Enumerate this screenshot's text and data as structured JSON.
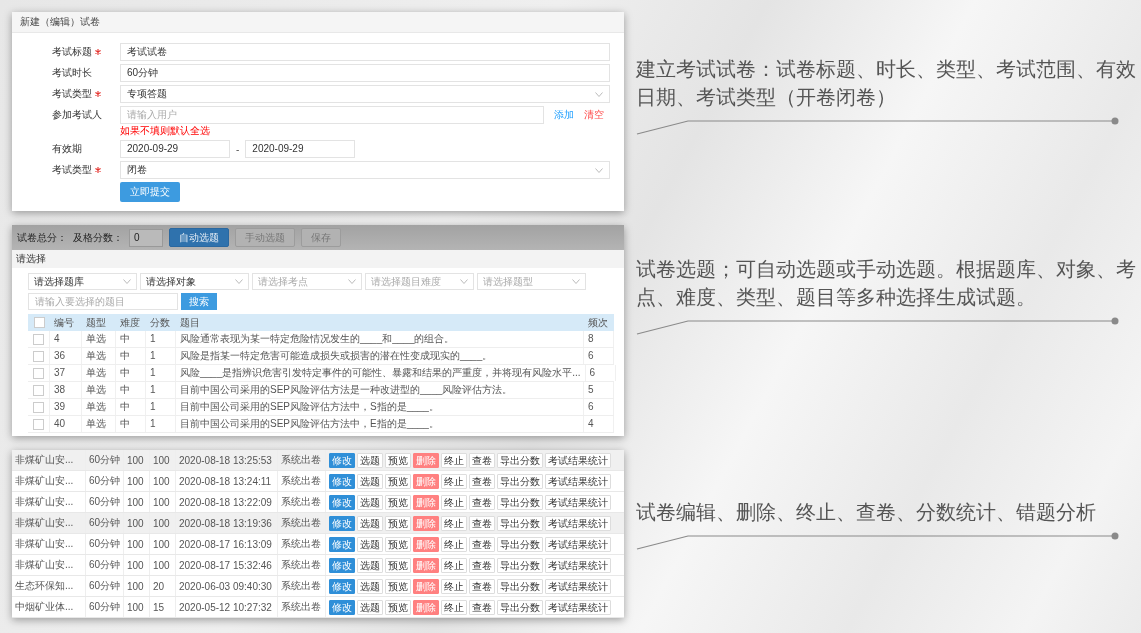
{
  "exam_form": {
    "title": "新建（编辑）试卷",
    "fields": [
      {
        "kind": "text",
        "label": "考试标题",
        "required": true,
        "value": "考试试卷"
      },
      {
        "kind": "text",
        "label": "考试时长",
        "required": false,
        "value": "60分钟"
      },
      {
        "kind": "select",
        "label": "考试类型",
        "required": true,
        "value": "专项答题"
      },
      {
        "kind": "users",
        "label": "参加考试人",
        "required": false,
        "placeholder": "请输入用户",
        "links": [
          {
            "label": "添加",
            "kind": "add"
          },
          {
            "label": "清空",
            "kind": "clear"
          }
        ],
        "hint": "如果不填则默认全选"
      },
      {
        "kind": "daterange",
        "label": "有效期",
        "required": false,
        "start": "2020-09-29",
        "separator": "-",
        "end": "2020-09-29"
      },
      {
        "kind": "select",
        "label": "考试类型",
        "required": true,
        "value": "闭卷"
      }
    ],
    "submit": "立即提交"
  },
  "question_picker": {
    "toolbar": {
      "total_label": "试卷总分：",
      "pass_label": "及格分数：",
      "pass_value": "0",
      "buttons": [
        {
          "label": "自动选题",
          "kind": "primary"
        },
        {
          "label": "手动选题",
          "kind": "plain"
        },
        {
          "label": "保存",
          "kind": "plain"
        }
      ]
    },
    "section_title": "请选择",
    "filters": [
      {
        "value": "请选择题库"
      },
      {
        "value": "请选择对象"
      },
      {
        "placeholder": "请选择考点"
      },
      {
        "placeholder": "请选择题目难度"
      },
      {
        "placeholder": "请选择题型"
      }
    ],
    "search": {
      "placeholder": "请输入要选择的题目",
      "button": "搜索"
    },
    "table": {
      "all_checked": false,
      "columns": [
        "编号",
        "题型",
        "难度",
        "分数",
        "题目",
        "频次"
      ],
      "rows": [
        {
          "checked": false,
          "cells": [
            "4",
            "单选",
            "中",
            "1",
            "风险通常表现为某一特定危险情况发生的____和____的组合。",
            "8"
          ]
        },
        {
          "checked": false,
          "cells": [
            "36",
            "单选",
            "中",
            "1",
            "风险是指某一特定危害可能造成损失或损害的潜在性变成现实的____。",
            "6"
          ]
        },
        {
          "checked": false,
          "cells": [
            "37",
            "单选",
            "中",
            "1",
            "风险____是指辨识危害引发特定事件的可能性、暴露和结果的严重度，并将现有风险水平...",
            "6"
          ]
        },
        {
          "checked": false,
          "cells": [
            "38",
            "单选",
            "中",
            "1",
            "目前中国公司采用的SEP风险评估方法是一种改进型的____风险评估方法。",
            "5"
          ]
        },
        {
          "checked": false,
          "cells": [
            "39",
            "单选",
            "中",
            "1",
            "目前中国公司采用的SEP风险评估方法中，S指的是____。",
            "6"
          ]
        },
        {
          "checked": false,
          "cells": [
            "40",
            "单选",
            "中",
            "1",
            "目前中国公司采用的SEP风险评估方法中，E指的是____。",
            "4"
          ]
        }
      ]
    }
  },
  "exam_list": {
    "rows": [
      {
        "highlighted": true,
        "cells": [
          "非煤矿山安...",
          "60分钟",
          "100",
          "100",
          "2020-08-18 13:25:53",
          "系统出卷"
        ],
        "actions": [
          {
            "label": "修改",
            "kind": "primary"
          },
          {
            "label": "选题",
            "kind": "plain"
          },
          {
            "label": "预览",
            "kind": "plain"
          },
          {
            "label": "删除",
            "kind": "danger"
          },
          {
            "label": "终止",
            "kind": "plain"
          },
          {
            "label": "查卷",
            "kind": "plain"
          },
          {
            "label": "导出分数",
            "kind": "plain"
          },
          {
            "label": "考试结果统计",
            "kind": "plain"
          }
        ]
      },
      {
        "highlighted": false,
        "cells": [
          "非煤矿山安...",
          "60分钟",
          "100",
          "100",
          "2020-08-18 13:24:11",
          "系统出卷"
        ],
        "actions": [
          {
            "label": "修改",
            "kind": "primary"
          },
          {
            "label": "选题",
            "kind": "plain"
          },
          {
            "label": "预览",
            "kind": "plain"
          },
          {
            "label": "删除",
            "kind": "danger"
          },
          {
            "label": "终止",
            "kind": "plain"
          },
          {
            "label": "查卷",
            "kind": "plain"
          },
          {
            "label": "导出分数",
            "kind": "plain"
          },
          {
            "label": "考试结果统计",
            "kind": "plain"
          }
        ]
      },
      {
        "highlighted": false,
        "cells": [
          "非煤矿山安...",
          "60分钟",
          "100",
          "100",
          "2020-08-18 13:22:09",
          "系统出卷"
        ],
        "actions": [
          {
            "label": "修改",
            "kind": "primary"
          },
          {
            "label": "选题",
            "kind": "plain"
          },
          {
            "label": "预览",
            "kind": "plain"
          },
          {
            "label": "删除",
            "kind": "danger"
          },
          {
            "label": "终止",
            "kind": "plain"
          },
          {
            "label": "查卷",
            "kind": "plain"
          },
          {
            "label": "导出分数",
            "kind": "plain"
          },
          {
            "label": "考试结果统计",
            "kind": "plain"
          }
        ]
      },
      {
        "highlighted": true,
        "cells": [
          "非煤矿山安...",
          "60分钟",
          "100",
          "100",
          "2020-08-18 13:19:36",
          "系统出卷"
        ],
        "actions": [
          {
            "label": "修改",
            "kind": "primary"
          },
          {
            "label": "选题",
            "kind": "plain"
          },
          {
            "label": "预览",
            "kind": "plain"
          },
          {
            "label": "删除",
            "kind": "danger"
          },
          {
            "label": "终止",
            "kind": "plain"
          },
          {
            "label": "查卷",
            "kind": "plain"
          },
          {
            "label": "导出分数",
            "kind": "plain"
          },
          {
            "label": "考试结果统计",
            "kind": "plain"
          }
        ]
      },
      {
        "highlighted": false,
        "cells": [
          "非煤矿山安...",
          "60分钟",
          "100",
          "100",
          "2020-08-17 16:13:09",
          "系统出卷"
        ],
        "actions": [
          {
            "label": "修改",
            "kind": "primary"
          },
          {
            "label": "选题",
            "kind": "plain"
          },
          {
            "label": "预览",
            "kind": "plain"
          },
          {
            "label": "删除",
            "kind": "danger"
          },
          {
            "label": "终止",
            "kind": "plain"
          },
          {
            "label": "查卷",
            "kind": "plain"
          },
          {
            "label": "导出分数",
            "kind": "plain"
          },
          {
            "label": "考试结果统计",
            "kind": "plain"
          }
        ]
      },
      {
        "highlighted": false,
        "cells": [
          "非煤矿山安...",
          "60分钟",
          "100",
          "100",
          "2020-08-17 15:32:46",
          "系统出卷"
        ],
        "actions": [
          {
            "label": "修改",
            "kind": "primary"
          },
          {
            "label": "选题",
            "kind": "plain"
          },
          {
            "label": "预览",
            "kind": "plain"
          },
          {
            "label": "删除",
            "kind": "danger"
          },
          {
            "label": "终止",
            "kind": "plain"
          },
          {
            "label": "查卷",
            "kind": "plain"
          },
          {
            "label": "导出分数",
            "kind": "plain"
          },
          {
            "label": "考试结果统计",
            "kind": "plain"
          }
        ]
      },
      {
        "highlighted": false,
        "cells": [
          "生态环保知...",
          "60分钟",
          "100",
          "20",
          "2020-06-03 09:40:30",
          "系统出卷"
        ],
        "actions": [
          {
            "label": "修改",
            "kind": "primary"
          },
          {
            "label": "选题",
            "kind": "plain"
          },
          {
            "label": "预览",
            "kind": "plain"
          },
          {
            "label": "删除",
            "kind": "danger"
          },
          {
            "label": "终止",
            "kind": "plain"
          },
          {
            "label": "查卷",
            "kind": "plain"
          },
          {
            "label": "导出分数",
            "kind": "plain"
          },
          {
            "label": "考试结果统计",
            "kind": "plain"
          }
        ]
      },
      {
        "highlighted": false,
        "cells": [
          "中烟矿业体...",
          "60分钟",
          "100",
          "15",
          "2020-05-12 10:27:32",
          "系统出卷"
        ],
        "actions": [
          {
            "label": "修改",
            "kind": "primary"
          },
          {
            "label": "选题",
            "kind": "plain"
          },
          {
            "label": "预览",
            "kind": "plain"
          },
          {
            "label": "删除",
            "kind": "danger"
          },
          {
            "label": "终止",
            "kind": "plain"
          },
          {
            "label": "查卷",
            "kind": "plain"
          },
          {
            "label": "导出分数",
            "kind": "plain"
          },
          {
            "label": "考试结果统计",
            "kind": "plain"
          }
        ]
      }
    ]
  },
  "notes": [
    {
      "text": "建立考试试卷：试卷标题、时长、类型、考试范围、有效日期、考试类型（开卷闭卷）"
    },
    {
      "text": "试卷选题；可自动选题或手动选题。根据题库、对象、考点、难度、类型、题目等多种选择生成试题。"
    },
    {
      "text": "试卷编辑、删除、终止、查卷、分数统计、错题分析"
    }
  ]
}
